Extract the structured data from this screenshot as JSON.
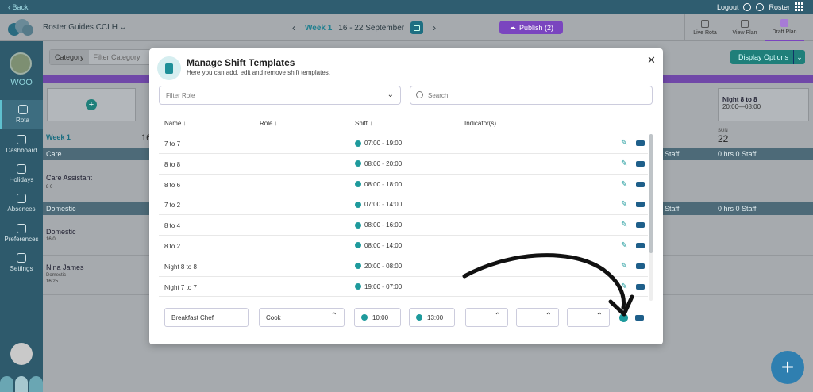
{
  "topbar": {
    "back": "‹ Back",
    "logout": "Logout",
    "roster": "Roster"
  },
  "header": {
    "roster_name": "Roster Guides CCLH",
    "week": "Week 1",
    "dates": "16 - 22 September",
    "publish": "Publish (2)",
    "tabs": [
      {
        "label": "Live Rota"
      },
      {
        "label": "View Plan"
      },
      {
        "label": "Draft Plan"
      }
    ]
  },
  "sidebar": {
    "org": "WOO",
    "items": [
      {
        "label": "Rota"
      },
      {
        "label": "Dashboard"
      },
      {
        "label": "Holidays"
      },
      {
        "label": "Absences"
      },
      {
        "label": "Preferences"
      },
      {
        "label": "Settings"
      }
    ]
  },
  "rota": {
    "filter_category": "Category",
    "filter_placeholder": "Filter Category",
    "display_options": "Display Options",
    "week_label": "Week 1",
    "night_tile_title": "Night 8 to 8",
    "night_tile_time": "20:00—08:00",
    "day_sun": "SUN",
    "day_sun_num": "22",
    "day_num_16": "16",
    "groups": [
      {
        "name": "Care",
        "summary_a": "Staff",
        "summary_b": "0 hrs  0 Staff"
      },
      {
        "name": "Domestic",
        "summary_a": "Staff",
        "summary_b": "0 hrs  0 Staff"
      }
    ],
    "staff": [
      {
        "name": "Care Assistant",
        "hours": "8   0"
      },
      {
        "name": "Domestic",
        "hours": "16   0"
      },
      {
        "name": "Nina James",
        "role": "Domestic",
        "hours": "16   25"
      }
    ]
  },
  "modal": {
    "title": "Manage Shift Templates",
    "subtitle": "Here you can add, edit and remove shift templates.",
    "role_filter_placeholder": "Filter Role",
    "search_placeholder": "Search",
    "columns": {
      "name": "Name ↓",
      "role": "Role ↓",
      "shift": "Shift ↓",
      "indicators": "Indicator(s)"
    },
    "rows": [
      {
        "name": "7 to 7",
        "shift": "07:00 - 19:00"
      },
      {
        "name": "8 to 8",
        "shift": "08:00 - 20:00"
      },
      {
        "name": "8 to 6",
        "shift": "08:00 - 18:00"
      },
      {
        "name": "7 to 2",
        "shift": "07:00 - 14:00"
      },
      {
        "name": "8 to 4",
        "shift": "08:00 - 16:00"
      },
      {
        "name": "8 to 2",
        "shift": "08:00 - 14:00"
      },
      {
        "name": "Night 8 to 8",
        "shift": "20:00 - 08:00"
      },
      {
        "name": "Night 7 to 7",
        "shift": "19:00 - 07:00"
      }
    ],
    "new_template": {
      "name": "Breakfast Chef",
      "role": "Cook",
      "start": "10:00",
      "end": "13:00"
    }
  },
  "colors": {
    "accent": "#1e9a9c",
    "publish": "#7a45bf",
    "sidebar": "#2e5a6c"
  }
}
